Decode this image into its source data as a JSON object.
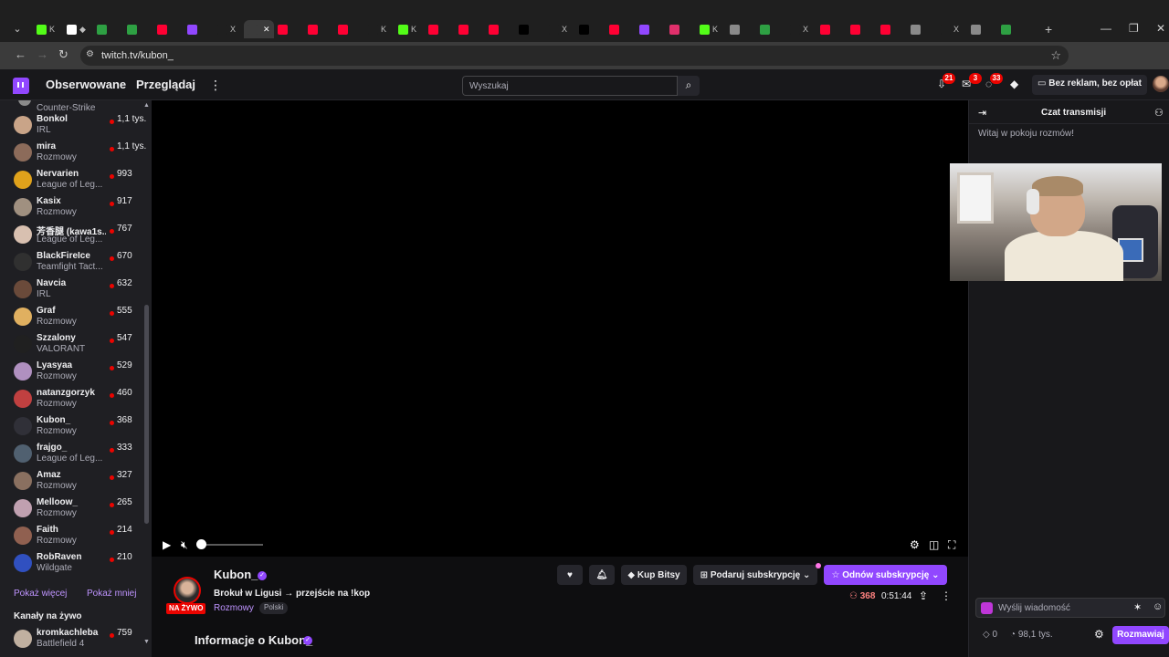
{
  "browser": {
    "url": "twitch.tv/kubon_",
    "tabs": [
      {
        "label": "K",
        "color": "#53fc18"
      },
      {
        "label": "◆",
        "color": "#ffffff"
      },
      {
        "label": "",
        "color": "#2ea043"
      },
      {
        "label": "",
        "color": "#2ea043"
      },
      {
        "label": "",
        "color": "#ff0033"
      },
      {
        "label": "",
        "color": "#9147ff"
      },
      {
        "label": "X",
        "color": "#1f1f1f"
      },
      {
        "label": "",
        "color": "#3b3b3b",
        "active": true
      },
      {
        "label": "",
        "color": "#ff0033"
      },
      {
        "label": "",
        "color": "#ff0033"
      },
      {
        "label": "",
        "color": "#ff0033"
      },
      {
        "label": "K",
        "color": "#1f1f1f"
      },
      {
        "label": "K",
        "color": "#53fc18"
      },
      {
        "label": "",
        "color": "#ff0033"
      },
      {
        "label": "",
        "color": "#ff0033"
      },
      {
        "label": "",
        "color": "#ff0033"
      },
      {
        "label": "",
        "color": "#000000"
      },
      {
        "label": "X",
        "color": "#1f1f1f"
      },
      {
        "label": "",
        "color": "#000000"
      },
      {
        "label": "",
        "color": "#ff0033"
      },
      {
        "label": "",
        "color": "#9147ff"
      },
      {
        "label": "",
        "color": "#e1306c"
      },
      {
        "label": "K",
        "color": "#53fc18"
      },
      {
        "label": "",
        "color": "#8a8a8a"
      },
      {
        "label": "",
        "color": "#2ea043"
      },
      {
        "label": "X",
        "color": "#1f1f1f"
      },
      {
        "label": "",
        "color": "#ff0033"
      },
      {
        "label": "",
        "color": "#ff0033"
      },
      {
        "label": "",
        "color": "#ff0033"
      },
      {
        "label": "",
        "color": "#8a8a8a"
      },
      {
        "label": "X",
        "color": "#1f1f1f"
      },
      {
        "label": "",
        "color": "#8a8a8a"
      },
      {
        "label": "",
        "color": "#2ea043"
      }
    ]
  },
  "topnav": {
    "following": "Obserwowane",
    "browse": "Przeglądaj",
    "search_placeholder": "Wyszukaj",
    "badges": {
      "notifications": "21",
      "inbox": "3",
      "activity": "33"
    },
    "ad_free": "Bez reklam, bez opłat"
  },
  "sidebar": {
    "top_category": "Counter-Strike",
    "channels": [
      {
        "name": "Bonkol",
        "category": "IRL",
        "viewers": "1,1 tys.",
        "color": "#c9a488"
      },
      {
        "name": "mira",
        "category": "Rozmowy",
        "viewers": "1,1 tys.",
        "color": "#8c6b5a"
      },
      {
        "name": "Nervarien",
        "category": "League of Leg...",
        "viewers": "993",
        "color": "#e0a21b"
      },
      {
        "name": "Kasix",
        "category": "Rozmowy",
        "viewers": "917",
        "color": "#a09080"
      },
      {
        "name": "芳香腿 (kawa1s...",
        "category": "League of Leg...",
        "viewers": "767",
        "color": "#d8c0b0"
      },
      {
        "name": "BlackFireIce",
        "category": "Teamfight Tact...",
        "viewers": "670",
        "color": "#303030"
      },
      {
        "name": "Navcia",
        "category": "IRL",
        "viewers": "632",
        "color": "#6a4a3a"
      },
      {
        "name": "Graf",
        "category": "Rozmowy",
        "viewers": "555",
        "color": "#e0b060"
      },
      {
        "name": "Szzalony",
        "category": "VALORANT",
        "viewers": "547",
        "color": "#202020"
      },
      {
        "name": "Lyasyaa",
        "category": "Rozmowy",
        "viewers": "529",
        "color": "#b090c0"
      },
      {
        "name": "natanzgorzyk",
        "category": "Rozmowy",
        "viewers": "460",
        "color": "#c04040"
      },
      {
        "name": "Kubon_",
        "category": "Rozmowy",
        "viewers": "368",
        "color": "#303038"
      },
      {
        "name": "frajgo_",
        "category": "League of Leg...",
        "viewers": "333",
        "color": "#506070"
      },
      {
        "name": "Amaz",
        "category": "Rozmowy",
        "viewers": "327",
        "color": "#8a7060"
      },
      {
        "name": "Melloow_",
        "category": "Rozmowy",
        "viewers": "265",
        "color": "#c0a0b0"
      },
      {
        "name": "Faith",
        "category": "Rozmowy",
        "viewers": "214",
        "color": "#906050"
      },
      {
        "name": "RobRaven",
        "category": "Wildgate",
        "viewers": "210",
        "color": "#3050c0"
      }
    ],
    "show_more": "Pokaż więcej",
    "show_less": "Pokaż mniej",
    "live_heading": "Kanały na żywo",
    "live_channel": {
      "name": "kromkachleba",
      "category": "Battlefield 4",
      "viewers": "759",
      "color": "#c0b0a0"
    }
  },
  "stream": {
    "streamer": "Kubon_",
    "live_label": "NA ŻYWO",
    "title": "Brokuł w Ligusi → przejście na !kop",
    "category": "Rozmowy",
    "language": "Polski",
    "viewers": "368",
    "uptime": "0:51:44",
    "bits_label": "Kup Bitsy",
    "gift_label": "Podaruj subskrypcję",
    "resub_label": "Odnów subskrypcję",
    "about": "Informacje o Kubon_"
  },
  "chat": {
    "title": "Czat transmisji",
    "welcome": "Witaj w pokoju rozmów!",
    "input_placeholder": "Wyślij wiadomość",
    "points": "0",
    "channel_points": "98,1 tys.",
    "send_label": "Rozmawiaj"
  }
}
